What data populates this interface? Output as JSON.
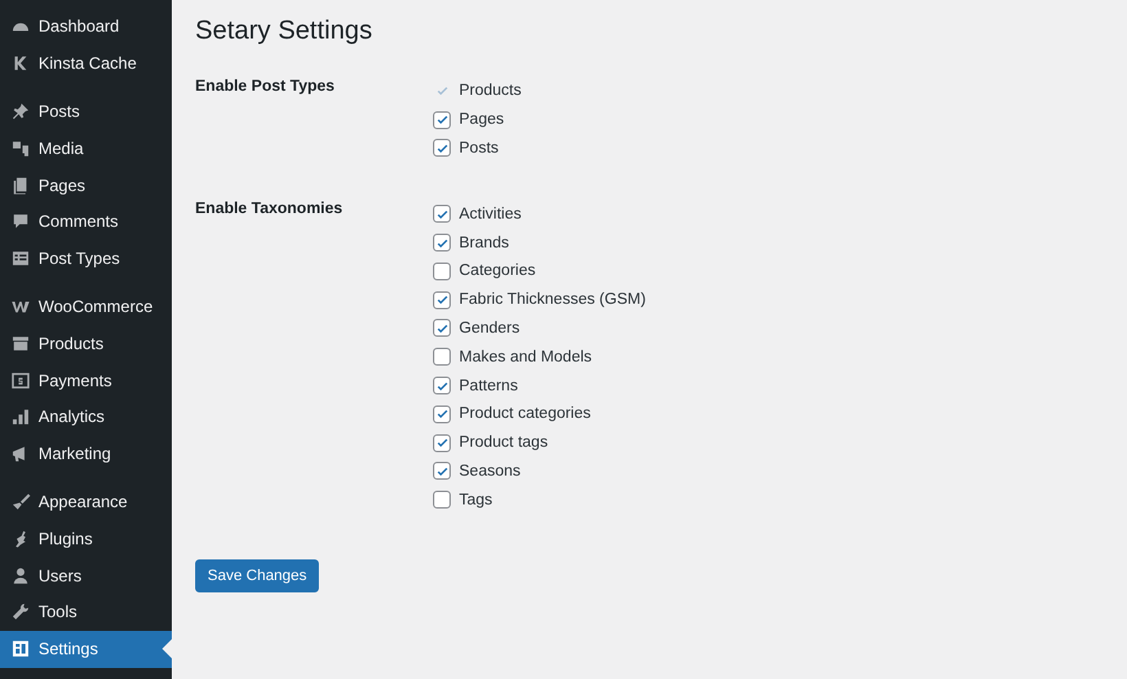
{
  "sidebar": {
    "groups": [
      {
        "items": [
          {
            "label": "Dashboard",
            "selected": false
          },
          {
            "label": "Kinsta Cache",
            "selected": false
          }
        ]
      },
      {
        "items": [
          {
            "label": "Posts",
            "selected": false
          },
          {
            "label": "Media",
            "selected": false
          },
          {
            "label": "Pages",
            "selected": false
          },
          {
            "label": "Comments",
            "selected": false
          },
          {
            "label": "Post Types",
            "selected": false
          }
        ]
      },
      {
        "items": [
          {
            "label": "WooCommerce",
            "selected": false
          },
          {
            "label": "Products",
            "selected": false
          },
          {
            "label": "Payments",
            "selected": false
          },
          {
            "label": "Analytics",
            "selected": false
          },
          {
            "label": "Marketing",
            "selected": false
          }
        ]
      },
      {
        "items": [
          {
            "label": "Appearance",
            "selected": false
          },
          {
            "label": "Plugins",
            "selected": false
          },
          {
            "label": "Users",
            "selected": false
          },
          {
            "label": "Tools",
            "selected": false
          },
          {
            "label": "Settings",
            "selected": true
          }
        ]
      }
    ]
  },
  "page": {
    "title": "Setary Settings",
    "sections": [
      {
        "label": "Enable Post Types",
        "options": [
          {
            "label": "Products",
            "checked": true,
            "disabled": true
          },
          {
            "label": "Pages",
            "checked": true,
            "disabled": false
          },
          {
            "label": "Posts",
            "checked": true,
            "disabled": false
          }
        ]
      },
      {
        "label": "Enable Taxonomies",
        "options": [
          {
            "label": "Activities",
            "checked": true,
            "disabled": false
          },
          {
            "label": "Brands",
            "checked": true,
            "disabled": false
          },
          {
            "label": "Categories",
            "checked": false,
            "disabled": false
          },
          {
            "label": "Fabric Thicknesses (GSM)",
            "checked": true,
            "disabled": false
          },
          {
            "label": "Genders",
            "checked": true,
            "disabled": false
          },
          {
            "label": "Makes and Models",
            "checked": false,
            "disabled": false
          },
          {
            "label": "Patterns",
            "checked": true,
            "disabled": false
          },
          {
            "label": "Product categories",
            "checked": true,
            "disabled": false
          },
          {
            "label": "Product tags",
            "checked": true,
            "disabled": false
          },
          {
            "label": "Seasons",
            "checked": true,
            "disabled": false
          },
          {
            "label": "Tags",
            "checked": false,
            "disabled": false
          }
        ]
      }
    ],
    "save_button": "Save Changes"
  }
}
